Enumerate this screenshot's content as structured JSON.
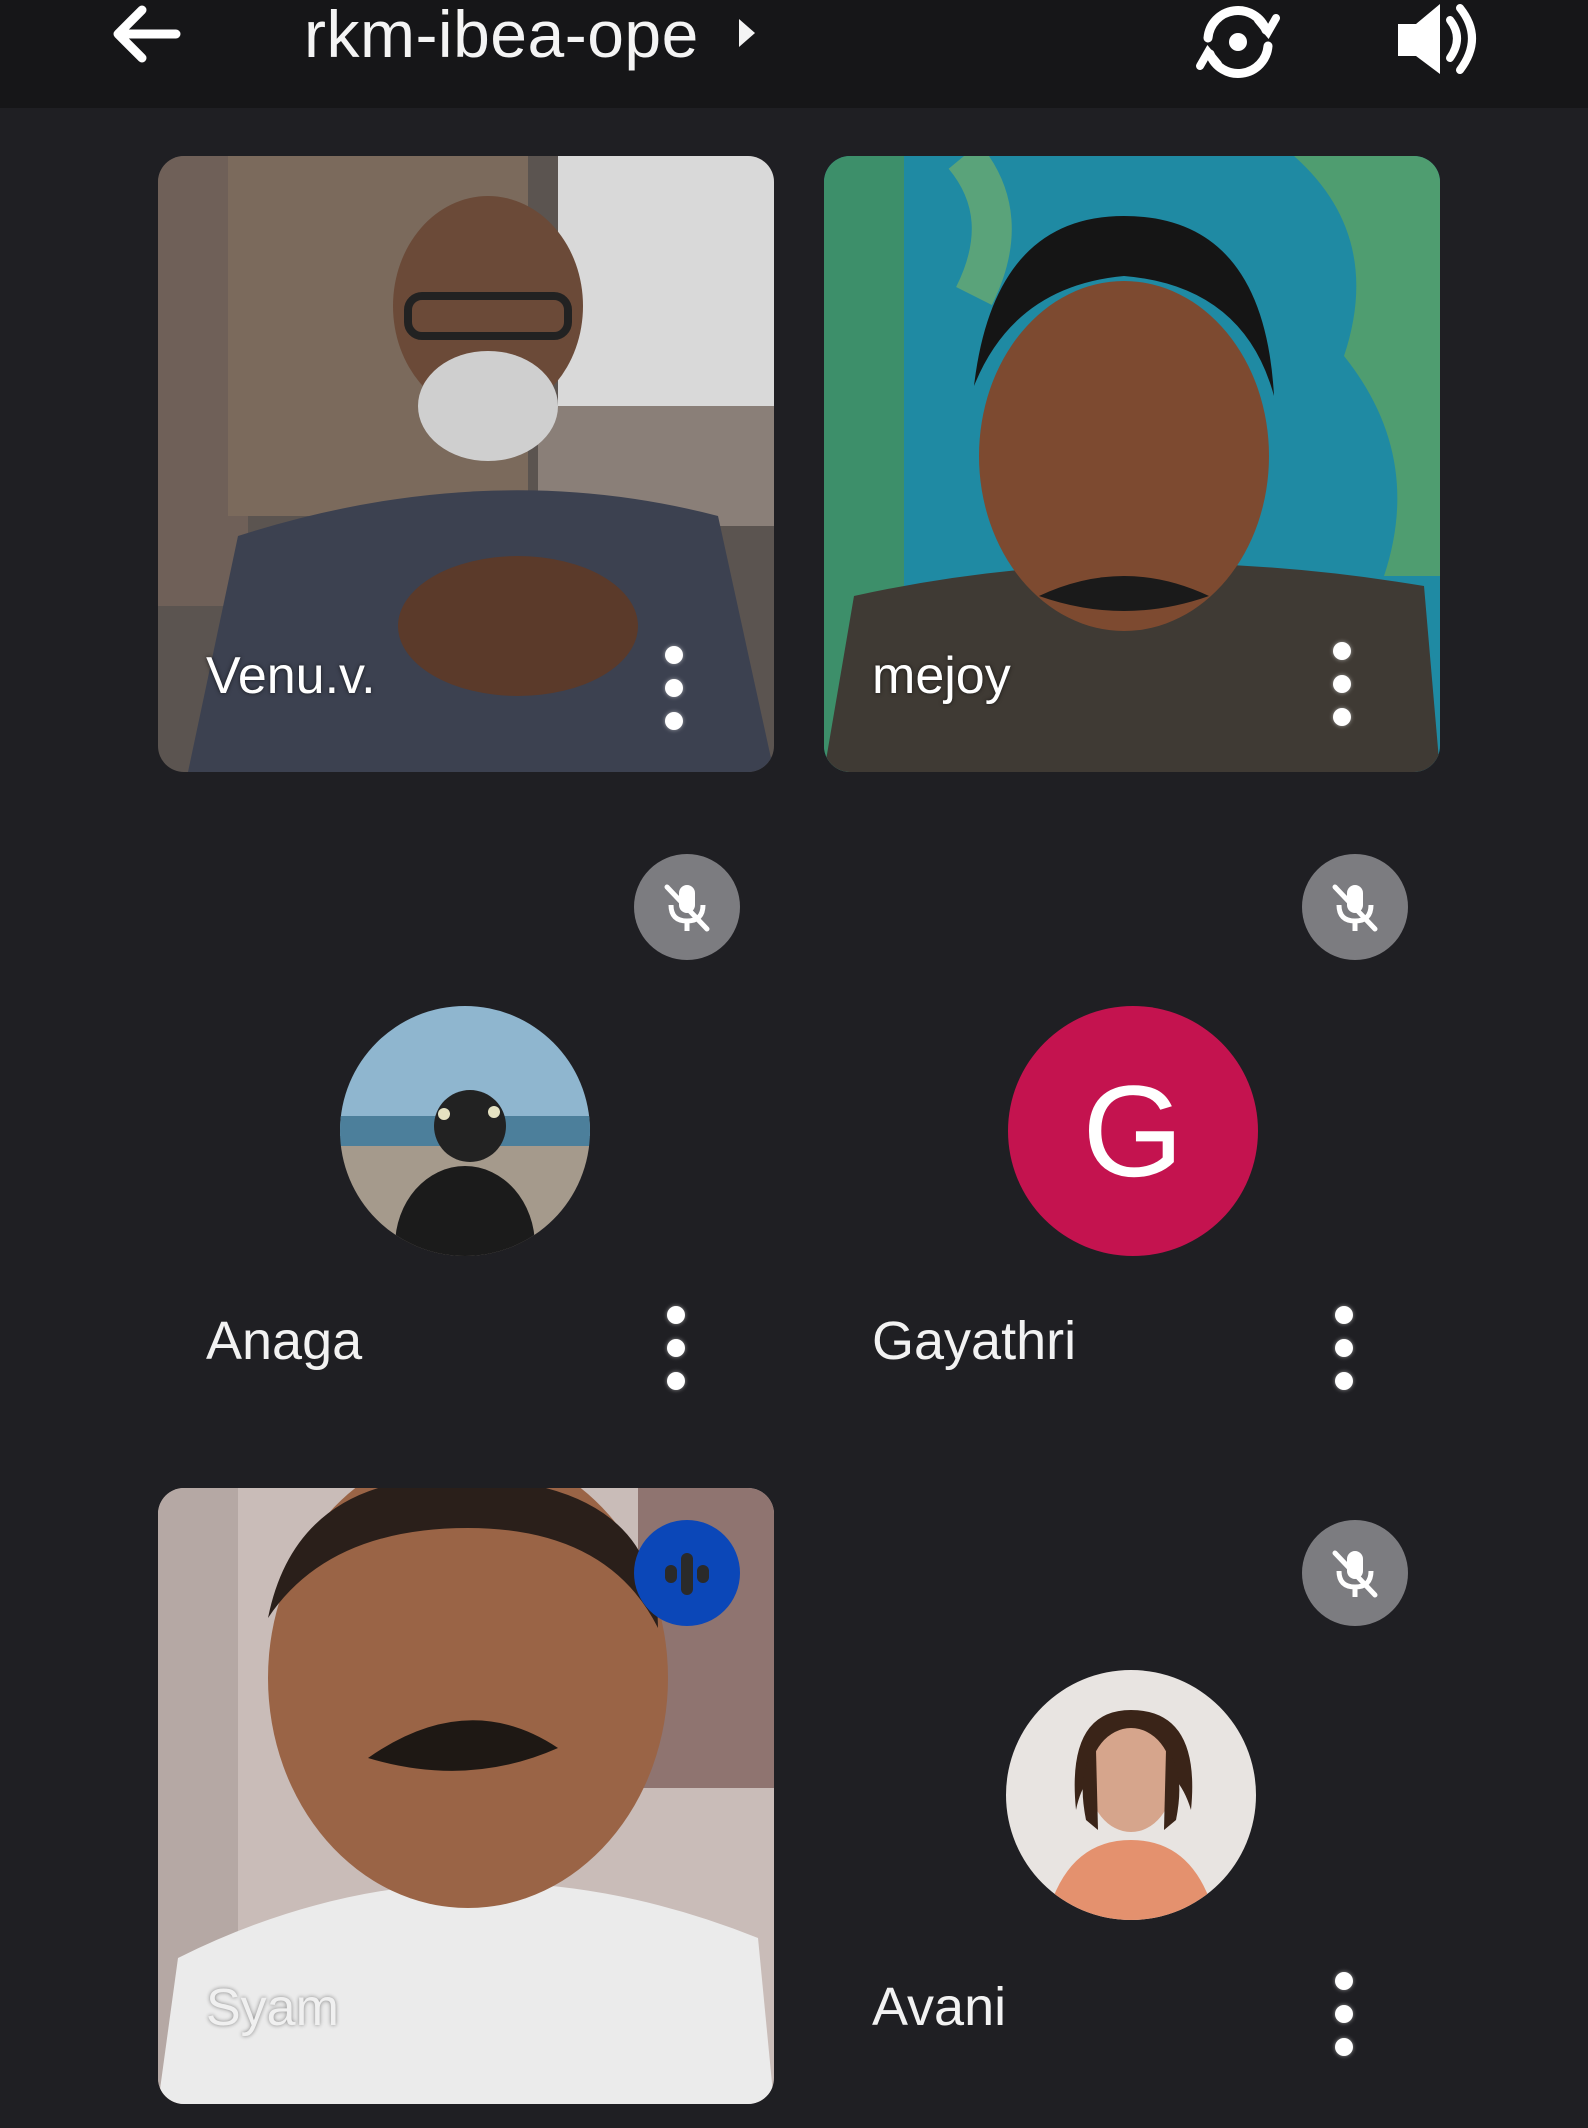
{
  "header": {
    "meeting_title": "rkm-ibea-ope",
    "back_icon": "arrow-left-icon",
    "switch_camera_icon": "switch-camera-icon",
    "speaker_icon": "speaker-icon"
  },
  "colors": {
    "background": "#1f1f23",
    "muted_badge": "#7c7c80",
    "speaking_badge": "#0b47b8",
    "gayathri_avatar": "#c4134f"
  },
  "participants": [
    {
      "name": "Venu.v.",
      "type": "video"
    },
    {
      "name": "mejoy",
      "type": "video"
    },
    {
      "name": "Anaga",
      "type": "avatar-photo",
      "muted": true
    },
    {
      "name": "Gayathri",
      "type": "avatar-letter",
      "initial": "G",
      "muted": true
    },
    {
      "name": "Syam",
      "type": "video",
      "speaking": true
    },
    {
      "name": "Avani",
      "type": "avatar-photo",
      "muted": true
    }
  ]
}
